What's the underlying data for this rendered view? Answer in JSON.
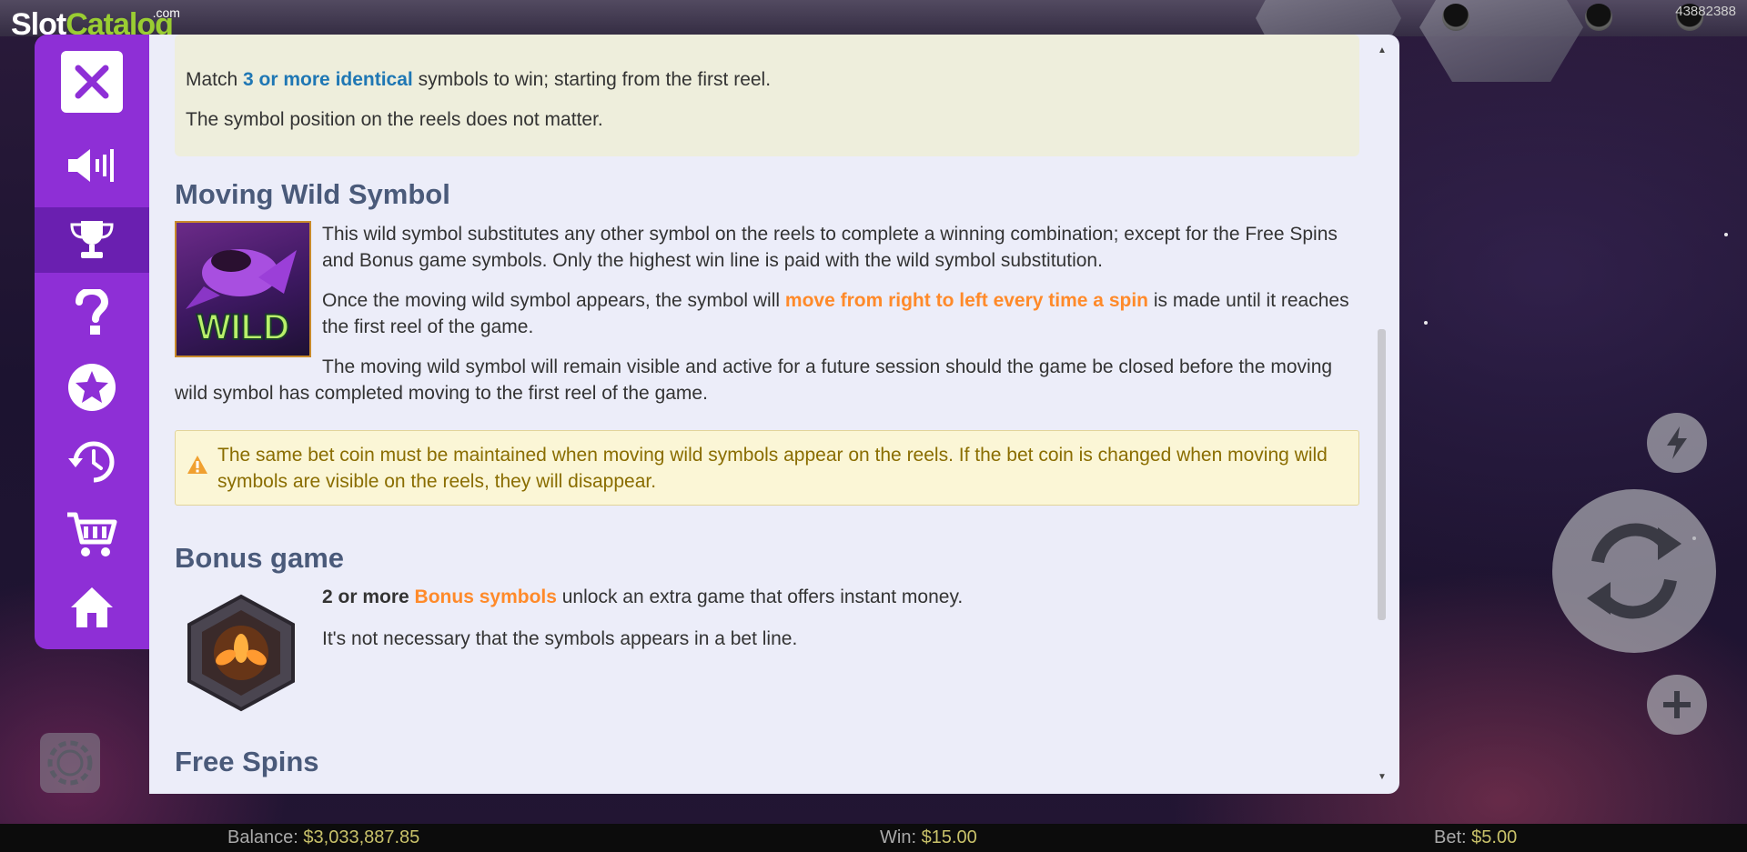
{
  "watermark": {
    "brand_part1": "Slot",
    "brand_part2": "Catalog",
    "suffix": ".com"
  },
  "session_id": "43882388",
  "side_menu": {
    "items": [
      {
        "name": "close",
        "icon": "close-icon"
      },
      {
        "name": "sound",
        "icon": "speaker-icon"
      },
      {
        "name": "paytable",
        "icon": "trophy-icon",
        "active": true
      },
      {
        "name": "help",
        "icon": "question-icon"
      },
      {
        "name": "favorites",
        "icon": "star-icon"
      },
      {
        "name": "history",
        "icon": "history-icon"
      },
      {
        "name": "shop",
        "icon": "cart-icon"
      },
      {
        "name": "home",
        "icon": "home-icon"
      }
    ],
    "accent": "#8e2fd6",
    "active_bg": "#6a1fb0"
  },
  "rules": {
    "line1_pre": "Match ",
    "line1_highlight": "3 or more identical",
    "line1_post": " symbols to win; starting from the first reel.",
    "line2": "The symbol position on the reels does not matter."
  },
  "moving_wild": {
    "title": "Moving Wild Symbol",
    "image_label": "WILD",
    "p1": "This wild symbol substitutes any other symbol on the reels to complete a winning combination; except for the Free Spins and Bonus game symbols. Only the highest win line is paid with the wild symbol substitution.",
    "p2_pre": "Once the moving wild symbol appears, the symbol will ",
    "p2_highlight": "move from right to left every time a spin",
    "p2_post": " is made until it reaches the first reel of the game.",
    "p3": "The moving wild symbol will remain visible and active for a future session should the game be closed before the moving wild symbol has completed moving to the first reel of the game."
  },
  "warning": {
    "icon": "warning-icon",
    "text": "The same bet coin must be maintained when moving wild symbols appear on the reels. If the bet coin is changed when moving wild symbols are visible on the reels, they will disappear."
  },
  "bonus_game": {
    "title": "Bonus game",
    "p1_bold": "2 or more ",
    "p1_highlight": "Bonus symbols",
    "p1_post": " unlock an extra game that offers instant money.",
    "p2": "It's not necessary that the symbols appears in a bet line."
  },
  "free_spins": {
    "title": "Free Spins"
  },
  "controls": {
    "turbo_icon": "lightning-icon",
    "spin_icon": "spin-icon",
    "bet_plus_icon": "plus-icon",
    "settings_icon": "chip-icon"
  },
  "bottom_bar": {
    "balance_label": "Balance: ",
    "balance_value": "$3,033,887.85",
    "win_label": "Win: ",
    "win_value": "$15.00",
    "bet_label": "Bet: ",
    "bet_value": "$5.00"
  },
  "colors": {
    "highlight_blue": "#1f77b4",
    "highlight_orange": "#ff8a2a",
    "heading": "#4a5a7a",
    "panel_bg": "#ecedf9",
    "warning_text": "#8a6d00"
  }
}
